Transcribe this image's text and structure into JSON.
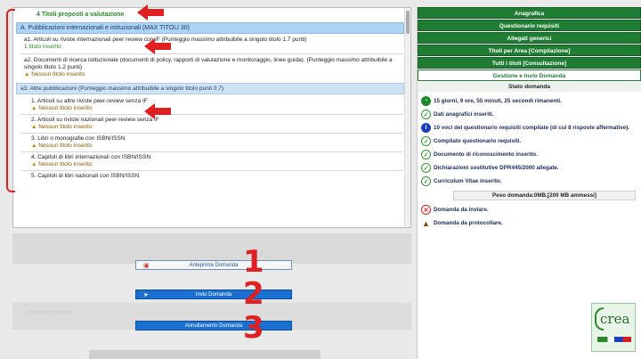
{
  "left_panel": {
    "heading": "4 Titoli proposti a valutazione",
    "section_a": "A. Pubblicazioni internazionali e istituzionali (MAX TITOLI 30)",
    "a1_text": "a1. Articoli su riviste internazionali peer review con IF (Punteggio massimo attribuibile a singolo titolo 1.7 punti)",
    "a1_status": "1 titolo inserito",
    "a2_text": "a2. Documenti di ricerca istituzionale (documenti di policy, rapporti di valutazione e monitoraggio, linee guida). (Punteggio massimo attribuibile a singolo titolo 1.2 punti)",
    "a2_status": "Nessun titolo inserito",
    "a3_text": "a3. Altre pubblicazioni (Punteggio massimo attribuibile a singolo titolo punti 0.7)",
    "sub_items": [
      {
        "label": "1. Articoli su altre riviste peer-review senza IF",
        "status": "Nessun titolo inserito"
      },
      {
        "label": "2. Articoli su riviste nazionali peer-review senza IF",
        "status": "Nessun titolo inserito"
      },
      {
        "label": "3. Libri o monografie con ISBN/ISSN",
        "status": "Nessun titolo inserito"
      },
      {
        "label": "4. Capitoli di libri internazionali con ISBN/ISSN",
        "status": "Nessun titolo inserito"
      },
      {
        "label": "5. Capitoli di libri nazionali con ISBN/ISSN",
        "status": ""
      }
    ]
  },
  "actions": {
    "preview": "Anteprima Domanda",
    "send": "Invio Domanda",
    "cancel": "Annullamento Domanda",
    "num1": "1",
    "num2": "2",
    "num3": "3"
  },
  "right_panel": {
    "nav": [
      "Anagrafica",
      "Questionario requisiti",
      "Allegati generici",
      "Titoli per Area [Compilazione]",
      "Tutti i titoli [Consultazione]",
      "Gestione e Invio Domanda"
    ],
    "stato_title": "Stato domanda",
    "status_rows": [
      {
        "icon": "clock-icon",
        "text": "15 giorni, 9 ore, 55 minuti, 25 secondi rimanenti."
      },
      {
        "icon": "check-icon",
        "text": "Dati anagrafici inseriti."
      },
      {
        "icon": "info-icon",
        "text": "10 voci del questionario requisiti compilate (di cui 8 risposte affermative)."
      },
      {
        "icon": "check-icon",
        "text": "Compilato questionario requisiti."
      },
      {
        "icon": "check-icon",
        "text": "Documento di riconoscimento inserito."
      },
      {
        "icon": "check-icon",
        "text": "Dichiarazioni sostitutive DPR445/2000 allegate."
      },
      {
        "icon": "check-icon",
        "text": "Curriculum Vitae inserito."
      }
    ],
    "peso": "Peso domanda:0MB,[200 MB ammessi]",
    "status_rows_2": [
      {
        "icon": "x-icon",
        "text": "Domanda da inviare."
      },
      {
        "icon": "warning-icon",
        "text": "Domanda da protocollare."
      }
    ],
    "logo_text": "crea"
  },
  "colors": {
    "accent_green": "#1e7d32",
    "section_blue": "#aed3f5",
    "button_blue": "#1a6fd0",
    "annotation_red": "#e02020"
  }
}
